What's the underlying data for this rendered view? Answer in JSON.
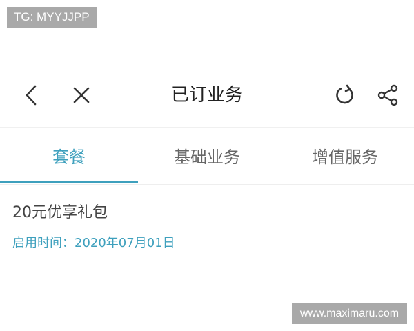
{
  "watermarks": {
    "top": "TG: MYYJJPP",
    "bottom": "www.maximaru.com"
  },
  "navbar": {
    "title": "已订业务",
    "icons": [
      "back-icon",
      "close-icon",
      "refresh-icon",
      "share-icon"
    ]
  },
  "tabs": [
    {
      "label": "套餐",
      "active": true
    },
    {
      "label": "基础业务",
      "active": false
    },
    {
      "label": "增值服务",
      "active": false
    }
  ],
  "packages": [
    {
      "name": "20元优享礼包",
      "start_date_label": "启用时间：2020年07月01日"
    }
  ],
  "colors": {
    "accent": "#3ea0bd",
    "text_primary": "#222222",
    "text_secondary": "#666666",
    "watermark_bg": "#a9a9a9"
  }
}
